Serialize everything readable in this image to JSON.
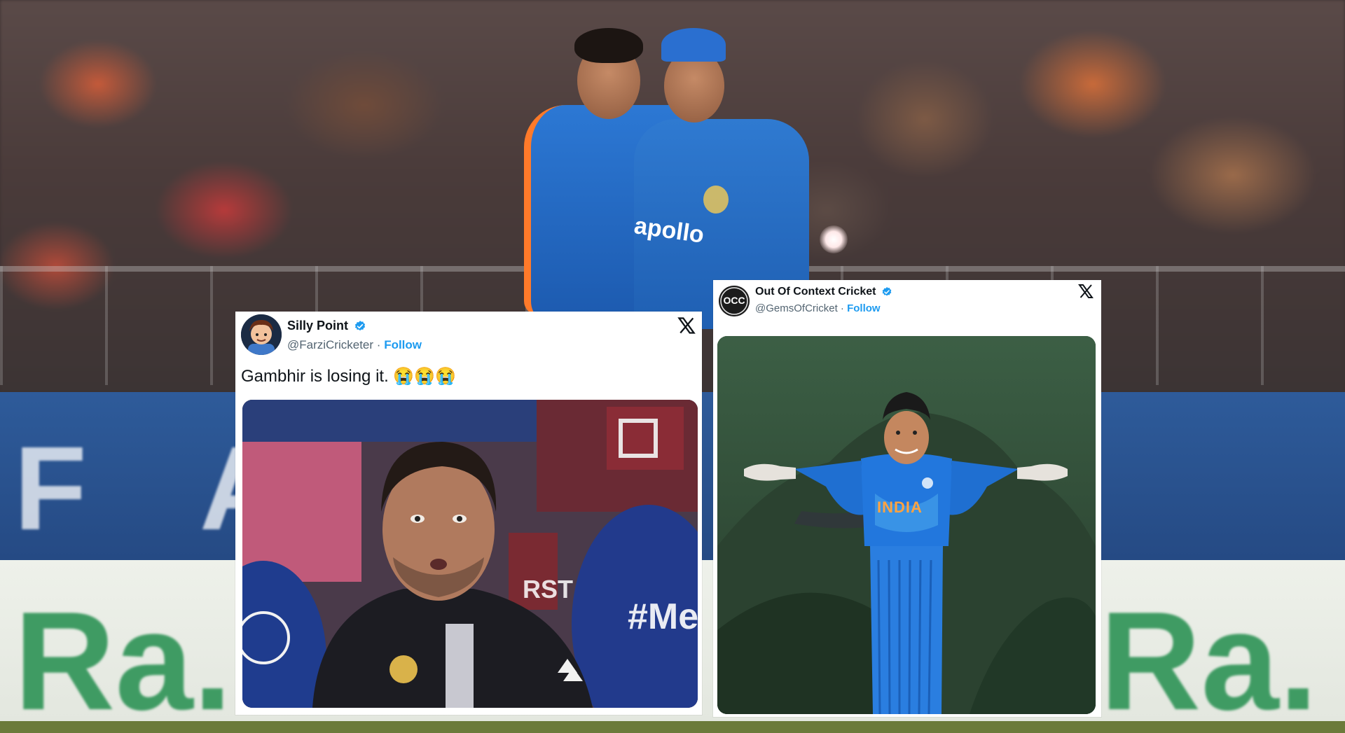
{
  "tweets": [
    {
      "name": "Silly Point",
      "handle": "@FarziCricketer",
      "separator": "·",
      "follow_label": "Follow",
      "text": "Gambhir is losing it. 😭😭😭",
      "media_jersey_tag": "#Men",
      "media_board_text": "RST"
    },
    {
      "name": "Out Of Context Cricket",
      "handle": "@GemsOfCricket",
      "separator": "·",
      "follow_label": "Follow",
      "avatar_text": "OCC",
      "media_jersey_text": "INDIA"
    }
  ],
  "background": {
    "board_text": "F A",
    "banner_text_left": "Ra.",
    "banner_text_right": "Ra.",
    "jersey_sponsor": "apollo"
  },
  "colors": {
    "verified": "#1d9bf0",
    "follow": "#1d9bf0",
    "india_blue": "#2f7ad1",
    "banner_green": "#3f9b63"
  },
  "icons": {
    "close": "x-logo-icon",
    "verified": "verified-badge-icon"
  }
}
